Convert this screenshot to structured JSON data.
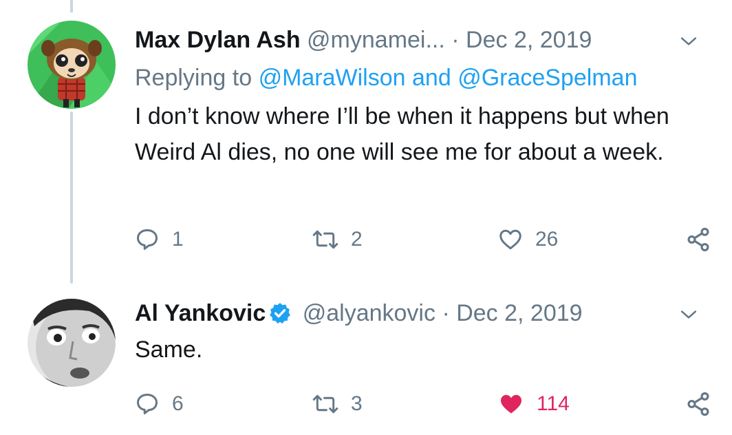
{
  "tweets": [
    {
      "display_name": "Max Dylan Ash",
      "handle": "@mynamei...",
      "date": "· Dec 2, 2019",
      "replying_prefix": "Replying to",
      "replying_user1": "@MaraWilson",
      "replying_and": "and",
      "replying_user2": "@GraceSpelman",
      "text": "I don’t know where I’ll be when it happens but when Weird Al dies, no one will see me for about a week.",
      "replies": "1",
      "retweets": "2",
      "likes": "26",
      "liked": false,
      "verified": false,
      "avatar_icon": "cartoon-character-avatar"
    },
    {
      "display_name": "Al Yankovic",
      "handle": "@alyankovic",
      "date": "· Dec 2, 2019",
      "text": "Same.",
      "replies": "6",
      "retweets": "3",
      "likes": "114",
      "liked": true,
      "verified": true,
      "avatar_icon": "grayscale-face-avatar"
    }
  ],
  "icons": [
    "reply-icon",
    "retweet-icon",
    "like-icon",
    "share-icon",
    "chevron-down-icon",
    "verified-badge-icon"
  ],
  "colors": {
    "link": "#1da1f2",
    "muted": "#657786",
    "like_active": "#e0245e",
    "thread_line": "#ccd6dd",
    "verified": "#1da1f2"
  }
}
